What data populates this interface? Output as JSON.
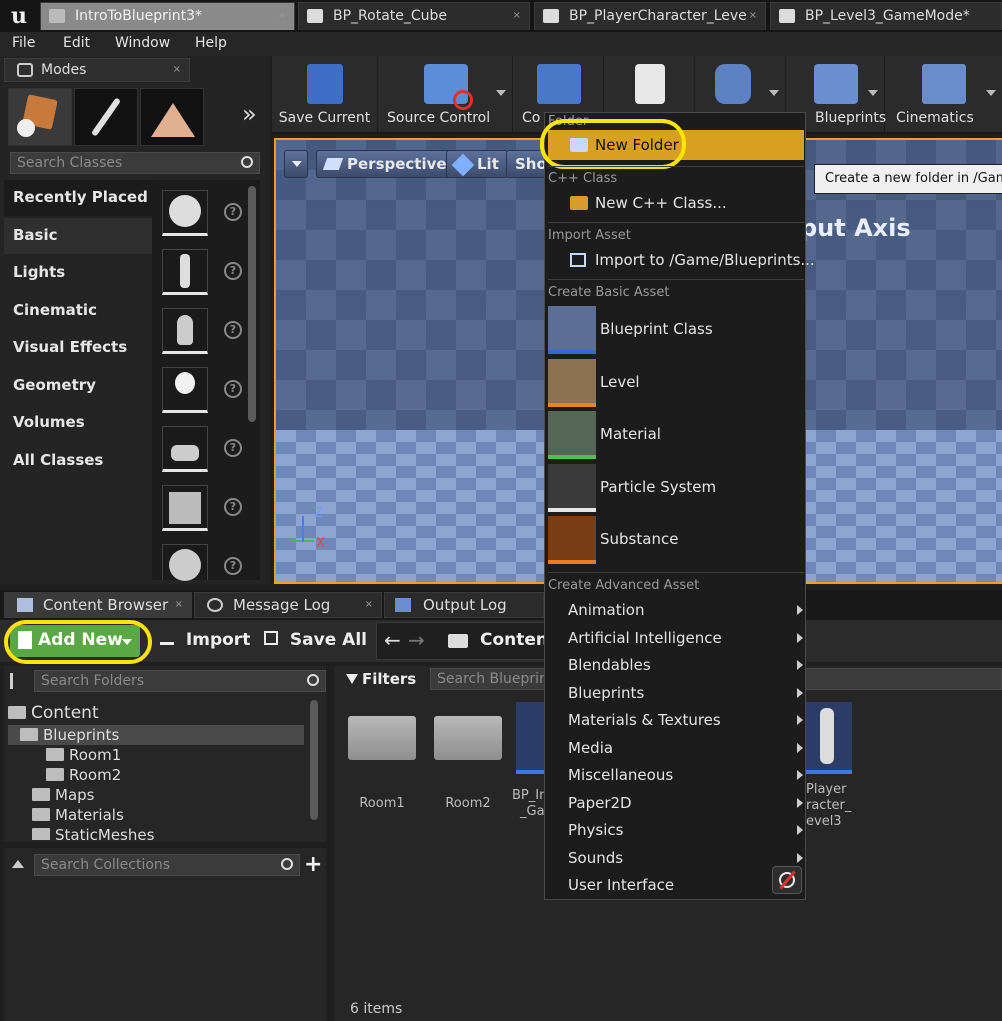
{
  "window": {
    "doc_tabs": [
      {
        "label": "IntroToBlueprint3*",
        "active": true
      },
      {
        "label": "BP_Rotate_Cube",
        "active": false
      },
      {
        "label": "BP_PlayerCharacter_Leve",
        "active": false
      },
      {
        "label": "BP_Level3_GameMode*",
        "active": false
      }
    ],
    "close_glyph": "×"
  },
  "menu": [
    "File",
    "Edit",
    "Window",
    "Help"
  ],
  "modes": {
    "title": "Modes",
    "search_placeholder": "Search Classes",
    "expand_glyph": "»",
    "categories": [
      "Recently Placed",
      "Basic",
      "Lights",
      "Cinematic",
      "Visual Effects",
      "Geometry",
      "Volumes",
      "All Classes"
    ],
    "help_glyph": "?"
  },
  "toolbar": {
    "buttons": [
      "Save Current",
      "Source Control",
      "Co",
      "",
      "",
      "",
      "Blueprints",
      "Cinematics"
    ]
  },
  "viewport": {
    "buttons": [
      "Perspective",
      "Lit",
      "Show"
    ],
    "overlay_text": "put Axis",
    "axis_z": "Z",
    "axis_x": "X"
  },
  "tooltip": "Create a new folder in /Game/Blueprints",
  "context_menu": {
    "folder_header": "Folder",
    "new_folder": "New Folder",
    "cpp_header": "C++ Class",
    "new_cpp": "New C++ Class...",
    "import_header": "Import Asset",
    "import_item": "Import to /Game/Blueprints...",
    "basic_header": "Create Basic Asset",
    "basic_items": [
      "Blueprint Class",
      "Level",
      "Material",
      "Particle System",
      "Substance"
    ],
    "advanced_header": "Create Advanced Asset",
    "advanced_items": [
      "Animation",
      "Artificial Intelligence",
      "Blendables",
      "Blueprints",
      "Materials & Textures",
      "Media",
      "Miscellaneous",
      "Paper2D",
      "Physics",
      "Sounds",
      "User Interface"
    ]
  },
  "bottom_tabs": [
    "Content Browser",
    "Message Log",
    "Output Log"
  ],
  "content_browser": {
    "add_new": "Add New",
    "import": "Import",
    "save_all": "Save All",
    "path": "Content",
    "search_folders": "Search Folders",
    "filters": "Filters",
    "search_assets": "Search Blueprin",
    "search_collections": "Search Collections",
    "add_glyph": "+",
    "tree": [
      {
        "label": "Content",
        "level": 0
      },
      {
        "label": "Blueprints",
        "level": 1
      },
      {
        "label": "Room1",
        "level": 2
      },
      {
        "label": "Room2",
        "level": 2
      },
      {
        "label": "Maps",
        "level": 1
      },
      {
        "label": "Materials",
        "level": 1
      },
      {
        "label": "StaticMeshes",
        "level": 1
      }
    ],
    "assets": [
      "Room1",
      "Room2",
      "BP_In",
      "_Gam",
      "Player",
      "racter_",
      "evel3"
    ],
    "item_count": "6 items"
  },
  "colors": {
    "accent_orange": "#d7a020",
    "highlight_ring": "#ffe400",
    "add_new_green": "#5aa845"
  }
}
